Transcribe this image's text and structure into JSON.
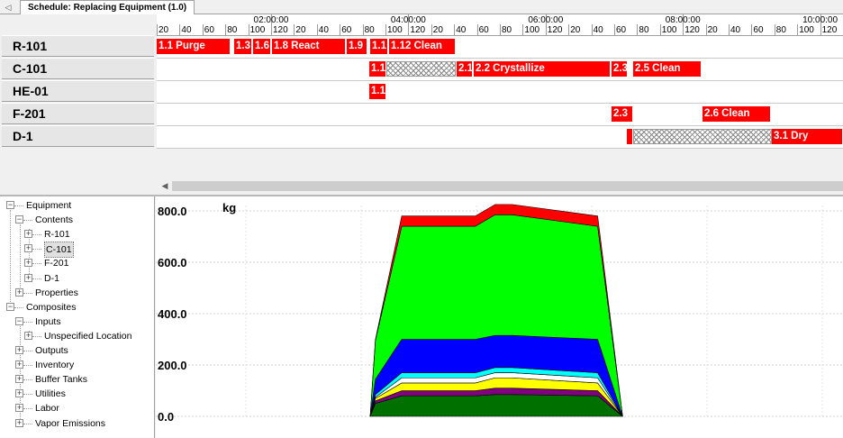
{
  "tab": {
    "title": "Schedule: Replacing Equipment (1.0)",
    "scroll_icon": "chevron-left-icon"
  },
  "gantt": {
    "major_labels": [
      "02:00:00",
      "04:00:00",
      "06:00:00",
      "08:00:00",
      "10:00:00"
    ],
    "minor_labels": [
      "20",
      "40",
      "60",
      "80",
      "100",
      "120",
      "20",
      "40",
      "60",
      "80",
      "100",
      "120",
      "20",
      "40",
      "60",
      "80",
      "100",
      "120",
      "20",
      "40",
      "60",
      "80",
      "100",
      "120",
      "20",
      "40",
      "60",
      "80",
      "100",
      "120"
    ],
    "rows": [
      {
        "name": "R-101",
        "tasks": [
          {
            "label": "1.1 Purge",
            "start": 0,
            "end": 82
          },
          {
            "label": "1.3",
            "start": 86,
            "end": 106
          },
          {
            "label": "1.6",
            "start": 107,
            "end": 127
          },
          {
            "label": "1.8 React",
            "start": 128,
            "end": 210
          },
          {
            "label": "1.9",
            "start": 211,
            "end": 234
          },
          {
            "label": "1.1",
            "start": 237,
            "end": 257
          },
          {
            "label": "1.12 Clean",
            "start": 258,
            "end": 332
          }
        ]
      },
      {
        "name": "C-101",
        "tasks": [
          {
            "label": "1.1",
            "start": 236,
            "end": 255
          },
          {
            "label": "",
            "start": 255,
            "end": 332,
            "hatched": true
          },
          {
            "label": "2.1",
            "start": 333,
            "end": 351
          },
          {
            "label": "2.2 Crystallize",
            "start": 352,
            "end": 504
          },
          {
            "label": "2.3",
            "start": 505,
            "end": 523
          },
          {
            "label": "2.5 Clean",
            "start": 529,
            "end": 605
          }
        ]
      },
      {
        "name": "HE-01",
        "tasks": [
          {
            "label": "1.1",
            "start": 236,
            "end": 255
          }
        ]
      },
      {
        "name": "F-201",
        "tasks": [
          {
            "label": "2.3",
            "start": 505,
            "end": 529
          },
          {
            "label": "2.6 Clean",
            "start": 606,
            "end": 682
          }
        ]
      },
      {
        "name": "D-1",
        "tasks": [
          {
            "label": "",
            "start": 522,
            "end": 529
          },
          {
            "label": "",
            "start": 529,
            "end": 683,
            "hatched": true
          },
          {
            "label": "3.1 Dry",
            "start": 683,
            "end": 762
          }
        ]
      }
    ]
  },
  "tree": {
    "nodes": [
      {
        "label": "Equipment",
        "level": 0,
        "expander": "−"
      },
      {
        "label": "Contents",
        "level": 1,
        "expander": "−"
      },
      {
        "label": "R-101",
        "level": 2,
        "expander": "+"
      },
      {
        "label": "C-101",
        "level": 2,
        "expander": "+",
        "selected": true
      },
      {
        "label": "F-201",
        "level": 2,
        "expander": "+"
      },
      {
        "label": "D-1",
        "level": 2,
        "expander": "+"
      },
      {
        "label": "Properties",
        "level": 1,
        "expander": "+"
      },
      {
        "label": "Composites",
        "level": 0,
        "expander": "−"
      },
      {
        "label": "Inputs",
        "level": 1,
        "expander": "−"
      },
      {
        "label": "Unspecified Location",
        "level": 2,
        "expander": "+"
      },
      {
        "label": "Outputs",
        "level": 1,
        "expander": "+"
      },
      {
        "label": "Inventory",
        "level": 1,
        "expander": "+"
      },
      {
        "label": "Buffer Tanks",
        "level": 1,
        "expander": "+"
      },
      {
        "label": "Utilities",
        "level": 1,
        "expander": "+"
      },
      {
        "label": "Labor",
        "level": 1,
        "expander": "+"
      },
      {
        "label": "Vapor Emissions",
        "level": 1,
        "expander": "+"
      }
    ]
  },
  "chart_data": {
    "type": "area",
    "ylabel": "kg",
    "ylim": [
      0,
      860
    ],
    "y_ticks": [
      "0.0",
      "200.0",
      "400.0",
      "600.0",
      "800.0"
    ],
    "grid": true,
    "x": [
      0,
      4,
      24,
      80,
      95,
      108,
      173,
      192
    ],
    "series": [
      {
        "color": "#007000",
        "values": [
          0,
          50,
          80,
          80,
          85,
          85,
          80,
          0
        ]
      },
      {
        "color": "#800080",
        "values": [
          0,
          10,
          20,
          20,
          25,
          25,
          20,
          0
        ]
      },
      {
        "color": "#ffff00",
        "values": [
          0,
          10,
          30,
          30,
          40,
          40,
          30,
          0
        ]
      },
      {
        "color": "#ffffff",
        "values": [
          0,
          5,
          20,
          20,
          20,
          20,
          20,
          0
        ]
      },
      {
        "color": "#00ffff",
        "values": [
          0,
          10,
          20,
          20,
          20,
          20,
          20,
          0
        ]
      },
      {
        "color": "#0000ff",
        "values": [
          0,
          60,
          130,
          130,
          125,
          125,
          130,
          0
        ]
      },
      {
        "color": "#00ff00",
        "values": [
          0,
          150,
          440,
          440,
          470,
          470,
          440,
          0
        ]
      },
      {
        "color": "#ff0000",
        "values": [
          0,
          5,
          40,
          40,
          40,
          40,
          40,
          0
        ]
      }
    ]
  }
}
